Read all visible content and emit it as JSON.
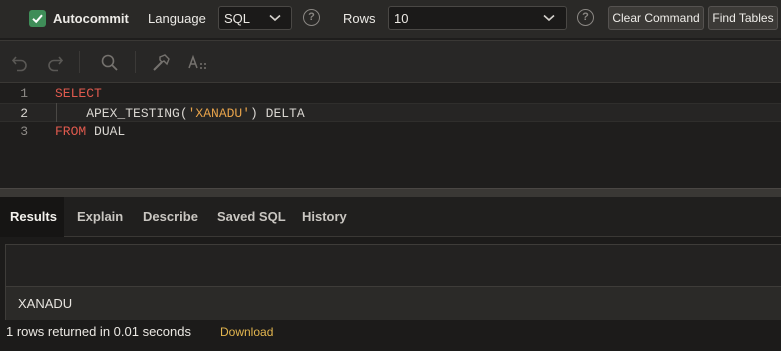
{
  "toolbar": {
    "autocommit_label": "Autocommit",
    "autocommit_checked": true,
    "language_label": "Language",
    "language_value": "SQL",
    "rows_label": "Rows",
    "rows_value": "10",
    "help_glyph": "?",
    "clear_command_label": "Clear Command",
    "find_tables_label": "Find Tables"
  },
  "editor_toolbar": {
    "icons": [
      "undo-icon",
      "redo-icon",
      "search-icon",
      "format-icon",
      "text-case-icon"
    ]
  },
  "editor": {
    "active_line": 2,
    "lines": [
      {
        "num": "1",
        "tokens": [
          {
            "t": "SELECT",
            "kind": "kw"
          }
        ]
      },
      {
        "num": "2",
        "tokens": [
          {
            "t": "    APEX_TESTING(",
            "kind": "plain"
          },
          {
            "t": "'XANADU'",
            "kind": "str"
          },
          {
            "t": ") DELTA",
            "kind": "plain"
          }
        ]
      },
      {
        "num": "3",
        "tokens": [
          {
            "t": "FROM",
            "kind": "kw"
          },
          {
            "t": " DUAL",
            "kind": "plain"
          }
        ]
      }
    ]
  },
  "tabs": [
    {
      "label": "Results",
      "active": true
    },
    {
      "label": "Explain",
      "active": false
    },
    {
      "label": "Describe",
      "active": false
    },
    {
      "label": "Saved SQL",
      "active": false
    },
    {
      "label": "History",
      "active": false
    }
  ],
  "results": {
    "rows": [
      [
        "XANADU"
      ]
    ],
    "status_text": "1 rows returned in 0.01 seconds",
    "download_label": "Download"
  },
  "colors": {
    "keyword": "#e05a4e",
    "string": "#e6a24a",
    "checkbox": "#3f8d58",
    "download_link": "#e3b64f"
  }
}
